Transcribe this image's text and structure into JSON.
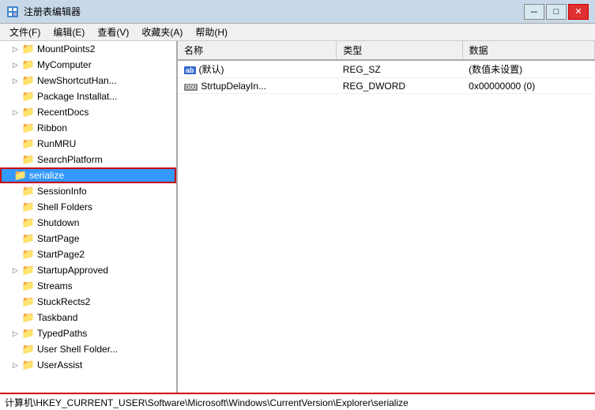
{
  "window": {
    "title": "注册表编辑器",
    "icon": "registry-icon"
  },
  "titlebar": {
    "minimize_label": "－",
    "restore_label": "□",
    "close_label": "✕"
  },
  "menubar": {
    "items": [
      {
        "label": "文件(F)"
      },
      {
        "label": "编辑(E)"
      },
      {
        "label": "查看(V)"
      },
      {
        "label": "收藏夹(A)"
      },
      {
        "label": "帮助(H)"
      }
    ]
  },
  "tree": {
    "items": [
      {
        "label": "MountPoints2",
        "indent": 1,
        "expanded": false,
        "selected": false
      },
      {
        "label": "MyComputer",
        "indent": 1,
        "expanded": false,
        "selected": false
      },
      {
        "label": "NewShortcutHan...",
        "indent": 1,
        "expanded": false,
        "selected": false
      },
      {
        "label": "Package Installat...",
        "indent": 1,
        "expanded": false,
        "selected": false
      },
      {
        "label": "RecentDocs",
        "indent": 1,
        "expanded": false,
        "selected": false
      },
      {
        "label": "Ribbon",
        "indent": 1,
        "expanded": false,
        "selected": false
      },
      {
        "label": "RunMRU",
        "indent": 1,
        "expanded": false,
        "selected": false
      },
      {
        "label": "SearchPlatform",
        "indent": 1,
        "expanded": false,
        "selected": false
      },
      {
        "label": "serialize",
        "indent": 1,
        "expanded": false,
        "selected": true
      },
      {
        "label": "SessionInfo",
        "indent": 1,
        "expanded": false,
        "selected": false
      },
      {
        "label": "Shell Folders",
        "indent": 1,
        "expanded": false,
        "selected": false
      },
      {
        "label": "Shutdown",
        "indent": 1,
        "expanded": false,
        "selected": false
      },
      {
        "label": "StartPage",
        "indent": 1,
        "expanded": false,
        "selected": false
      },
      {
        "label": "StartPage2",
        "indent": 1,
        "expanded": false,
        "selected": false
      },
      {
        "label": "StartupApproved",
        "indent": 1,
        "expanded": false,
        "selected": false
      },
      {
        "label": "Streams",
        "indent": 1,
        "expanded": false,
        "selected": false
      },
      {
        "label": "StuckRects2",
        "indent": 1,
        "expanded": false,
        "selected": false
      },
      {
        "label": "Taskband",
        "indent": 1,
        "expanded": false,
        "selected": false
      },
      {
        "label": "TypedPaths",
        "indent": 1,
        "expanded": false,
        "selected": false
      },
      {
        "label": "User Shell Folder...",
        "indent": 1,
        "expanded": false,
        "selected": false
      },
      {
        "label": "UserAssist",
        "indent": 1,
        "expanded": false,
        "selected": false
      }
    ]
  },
  "table": {
    "headers": [
      "名称",
      "类型",
      "数据"
    ],
    "rows": [
      {
        "name": "(默认)",
        "type": "REG_SZ",
        "data": "(数值未设置)",
        "icon": "ab"
      },
      {
        "name": "StrtupDelayIn...",
        "type": "REG_DWORD",
        "data": "0x00000000 (0)",
        "icon": "dword"
      }
    ]
  },
  "statusbar": {
    "text": "计算机\\HKEY_CURRENT_USER\\Software\\Microsoft\\Windows\\CurrentVersion\\Explorer\\serialize"
  }
}
